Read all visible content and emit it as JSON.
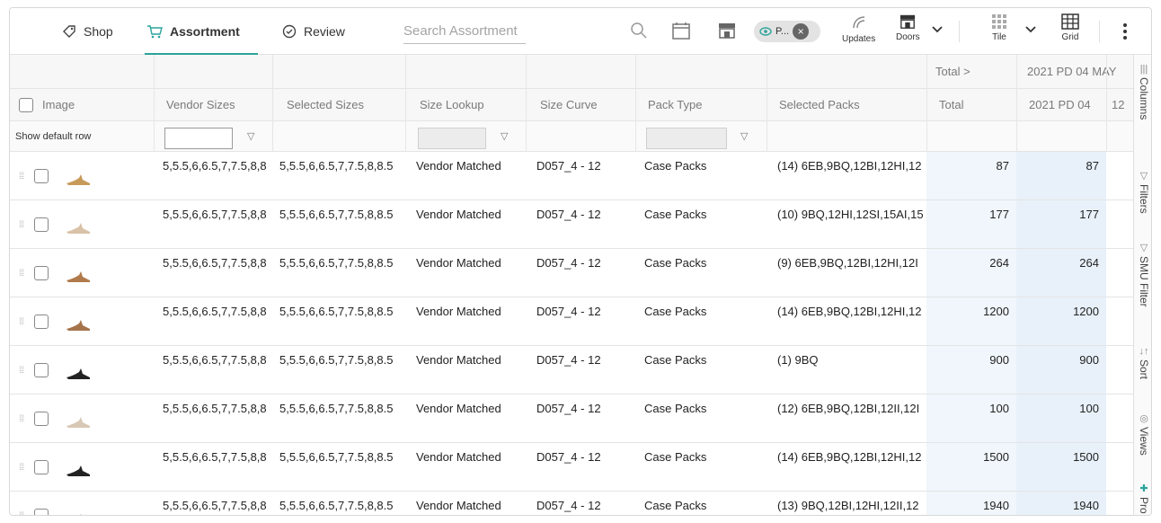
{
  "toolbar": {
    "tabs": [
      {
        "label": "Shop",
        "icon": "tag-icon"
      },
      {
        "label": "Assortment",
        "icon": "cart-icon"
      },
      {
        "label": "Review",
        "icon": "check-circle-icon"
      }
    ],
    "search_placeholder": "Search Assortment",
    "chip_label": "P...",
    "updates_label": "Updates",
    "doors_label": "Doors",
    "tile_label": "Tile",
    "grid_label": "Grid"
  },
  "group_header": {
    "total": "Total >",
    "period": "2021 PD 04 MAY"
  },
  "columns": {
    "image": "Image",
    "vendor_sizes": "Vendor Sizes",
    "selected_sizes": "Selected Sizes",
    "size_lookup": "Size Lookup",
    "size_curve": "Size Curve",
    "pack_type": "Pack Type",
    "selected_packs": "Selected Packs",
    "total": "Total",
    "period": "2021 PD 04",
    "extra": "12"
  },
  "filter_row": {
    "label": "Show default row"
  },
  "rows": [
    {
      "vendor_sizes": "5,5.5,6,6.5,7,7.5,8,8",
      "selected_sizes": "5,5.5,6,6.5,7,7.5,8,8.5",
      "size_lookup": "Vendor Matched",
      "size_curve": "D057_4 - 12",
      "pack_type": "Case Packs",
      "selected_packs": "(14) 6EB,9BQ,12BI,12HI,12",
      "total": "87",
      "period": "87"
    },
    {
      "vendor_sizes": "5,5.5,6,6.5,7,7.5,8,8",
      "selected_sizes": "5,5.5,6,6.5,7,7.5,8,8.5",
      "size_lookup": "Vendor Matched",
      "size_curve": "D057_4 - 12",
      "pack_type": "Case Packs",
      "selected_packs": "(10) 9BQ,12HI,12SI,15AI,15",
      "total": "177",
      "period": "177"
    },
    {
      "vendor_sizes": "5,5.5,6,6.5,7,7.5,8,8",
      "selected_sizes": "5,5.5,6,6.5,7,7.5,8,8.5",
      "size_lookup": "Vendor Matched",
      "size_curve": "D057_4 - 12",
      "pack_type": "Case Packs",
      "selected_packs": "(9) 6EB,9BQ,12BI,12HI,12I",
      "total": "264",
      "period": "264"
    },
    {
      "vendor_sizes": "5,5.5,6,6.5,7,7.5,8,8",
      "selected_sizes": "5,5.5,6,6.5,7,7.5,8,8.5",
      "size_lookup": "Vendor Matched",
      "size_curve": "D057_4 - 12",
      "pack_type": "Case Packs",
      "selected_packs": "(14) 6EB,9BQ,12BI,12HI,12",
      "total": "1200",
      "period": "1200"
    },
    {
      "vendor_sizes": "5,5.5,6,6.5,7,7.5,8,8",
      "selected_sizes": "5,5.5,6,6.5,7,7.5,8,8.5",
      "size_lookup": "Vendor Matched",
      "size_curve": "D057_4 - 12",
      "pack_type": "Case Packs",
      "selected_packs": "(1) 9BQ",
      "total": "900",
      "period": "900"
    },
    {
      "vendor_sizes": "5,5.5,6,6.5,7,7.5,8,8",
      "selected_sizes": "5,5.5,6,6.5,7,7.5,8,8.5",
      "size_lookup": "Vendor Matched",
      "size_curve": "D057_4 - 12",
      "pack_type": "Case Packs",
      "selected_packs": "(12) 6EB,9BQ,12BI,12II,12I",
      "total": "100",
      "period": "100"
    },
    {
      "vendor_sizes": "5,5.5,6,6.5,7,7.5,8,8",
      "selected_sizes": "5,5.5,6,6.5,7,7.5,8,8.5",
      "size_lookup": "Vendor Matched",
      "size_curve": "D057_4 - 12",
      "pack_type": "Case Packs",
      "selected_packs": "(14) 6EB,9BQ,12BI,12HI,12",
      "total": "1500",
      "period": "1500"
    },
    {
      "vendor_sizes": "5,5.5,6,6.5,7,7.5,8,8",
      "selected_sizes": "5,5.5,6,6.5,7,7.5,8,8.5",
      "size_lookup": "Vendor Matched",
      "size_curve": "D057_4 - 12",
      "pack_type": "Case Packs",
      "selected_packs": "(13) 9BQ,12BI,12HI,12II,12",
      "total": "1940",
      "period": "1940"
    }
  ],
  "side_panel": [
    {
      "label": "Columns",
      "icon": "columns-icon"
    },
    {
      "label": "Filters",
      "icon": "filter-icon"
    },
    {
      "label": "SMU Filter",
      "icon": "filter-icon"
    },
    {
      "label": "Sort",
      "icon": "sort-icon"
    },
    {
      "label": "Views",
      "icon": "eye-icon"
    },
    {
      "label": "Pro",
      "icon": "plus-icon"
    }
  ]
}
